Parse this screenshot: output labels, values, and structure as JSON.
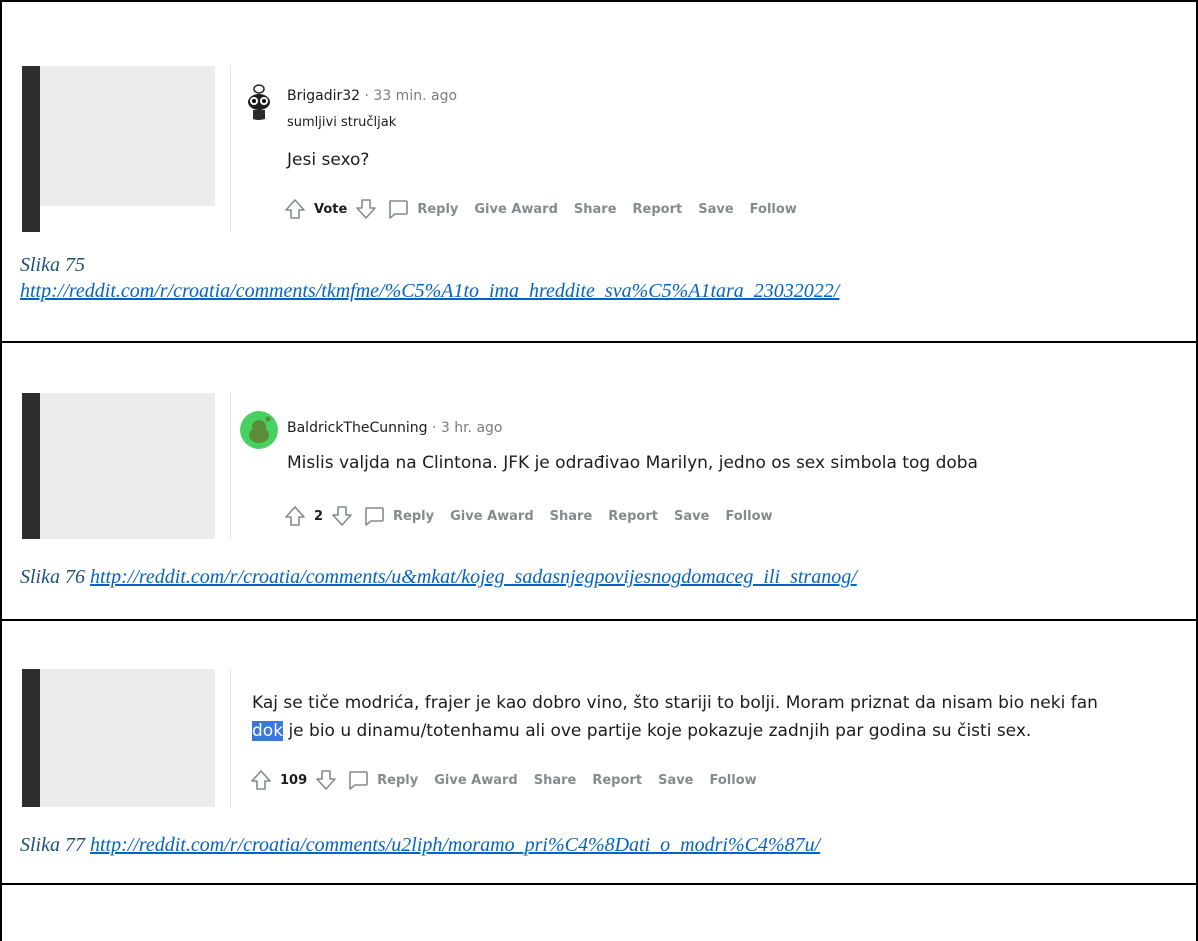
{
  "entries": [
    {
      "username": "Brigadir32",
      "separator": " · ",
      "time": "33 min. ago",
      "flair": "sumljivi stručljak",
      "body_lines": [
        "Jesi sexo?"
      ],
      "score": "Vote",
      "actions": [
        "Reply",
        "Give Award",
        "Share",
        "Report",
        "Save",
        "Follow"
      ],
      "caption_label": "Slika 75",
      "caption_url": "http://reddit.com/r/croatia/comments/tkmfme/%C5%A1to_ima_hreddite_sva%C5%A1tara_23032022/"
    },
    {
      "username": "BaldrickTheCunning",
      "separator": " · ",
      "time": "3 hr. ago",
      "flair": "",
      "body_lines": [
        "Mislis valjda na Clintona. JFK je odrađivao Marilyn, jedno os sex simbola tog doba"
      ],
      "score": "2",
      "actions": [
        "Reply",
        "Give Award",
        "Share",
        "Report",
        "Save",
        "Follow"
      ],
      "caption_label": "Slika 76 ",
      "caption_url": "http://reddit.com/r/croatia/comments/u&mkat/kojeg_sadasnjegpovijesnogdomaceg_ili_stranog/"
    },
    {
      "username": "",
      "time": "",
      "flair": "",
      "body_lines": [
        "Kaj se tiče modrića, frajer je kao dobro vino, što stariji to bolji. Moram priznat da nisam bio neki fan",
        "je bio u dinamu/totenhamu ali ove partije koje pokazuje zadnjih par godina su čisti sex."
      ],
      "highlight": "dok",
      "score": "109",
      "actions": [
        "Reply",
        "Give Award",
        "Share",
        "Report",
        "Save",
        "Follow"
      ],
      "caption_label": "Slika 77 ",
      "caption_url": "http://reddit.com/r/croatia/comments/u2liph/moramo_pri%C4%8Dati_o_modri%C4%87u/"
    }
  ]
}
